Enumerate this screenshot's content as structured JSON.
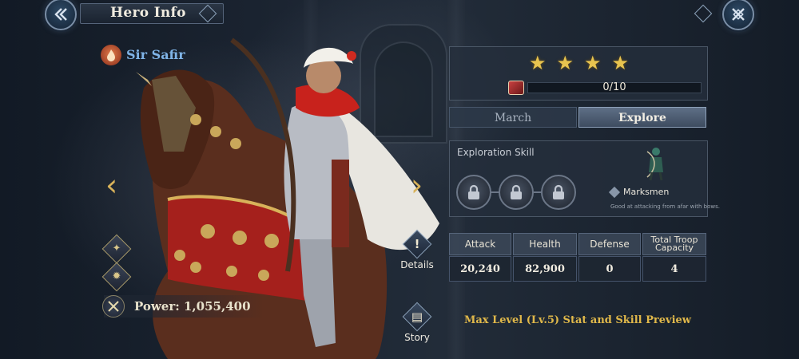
{
  "header": {
    "title": "Hero Info",
    "back_icon": "double-chevron-left-icon",
    "close_icon": "crossed-emblem-icon"
  },
  "hero": {
    "name": "Sir Safir",
    "faction_icon": "flame-icon",
    "name_color": "#7fb3e6",
    "power_label": "Power: 1,055,400",
    "power_icon": "crossed-swords-icon",
    "left_icons": [
      "trident-badge-icon",
      "sunburst-badge-icon"
    ],
    "actions": [
      {
        "label": "Details",
        "icon": "exclamation-icon"
      },
      {
        "label": "Story",
        "icon": "book-icon"
      }
    ]
  },
  "stars": {
    "count": 4,
    "icon": "star-icon",
    "color": "#e8c44f"
  },
  "fragments": {
    "label": "0/10",
    "current": 0,
    "required": 10,
    "icon": "hero-fragment-icon"
  },
  "tabs": [
    {
      "label": "March",
      "active": false
    },
    {
      "label": "Explore",
      "active": true
    }
  ],
  "exploration": {
    "heading": "Exploration Skill",
    "slots": [
      {
        "state": "locked",
        "icon": "lock-icon"
      },
      {
        "state": "locked",
        "icon": "lock-icon"
      },
      {
        "state": "locked",
        "icon": "lock-icon"
      }
    ],
    "troop_type": "Marksmen",
    "troop_icon": "archer-icon",
    "troop_desc": "Good at attacking from afar with bows."
  },
  "stats": {
    "headers": [
      "Attack",
      "Health",
      "Defense",
      "Total Troop Capacity"
    ],
    "values": [
      "20,240",
      "82,900",
      "0",
      "4"
    ]
  },
  "footer": {
    "max_preview": "Max Level (Lv.5) Stat and Skill Preview"
  },
  "colors": {
    "accent_gold": "#e0b84a",
    "panel": "#242e3c",
    "tab_active": "#5e6f86"
  }
}
